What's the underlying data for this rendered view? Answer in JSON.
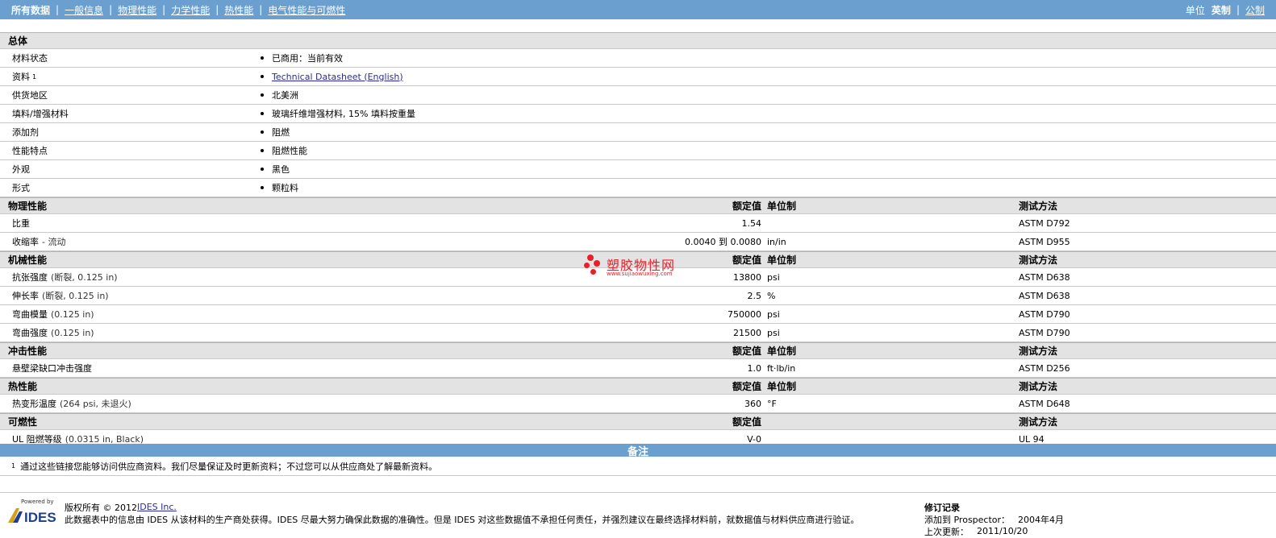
{
  "nav": {
    "tabs": [
      "所有数据",
      "一般信息",
      "物理性能",
      "力学性能",
      "热性能",
      "电气性能与可燃性"
    ],
    "separator": "|",
    "units_label": "单位",
    "unit_imperial": "英制",
    "unit_metric": "公制"
  },
  "general": {
    "title": "总体",
    "rows": [
      {
        "name": "材料状态",
        "sup": "",
        "value": "已商用：当前有效",
        "link": false
      },
      {
        "name": "资料",
        "sup": "1",
        "value": "Technical Datasheet (English)",
        "link": true
      },
      {
        "name": "供货地区",
        "sup": "",
        "value": "北美洲",
        "link": false
      },
      {
        "name": "填料/增强材料",
        "sup": "",
        "value": "玻璃纤维增强材料, 15% 填料按重量",
        "link": false
      },
      {
        "name": "添加剂",
        "sup": "",
        "value": "阻燃",
        "link": false
      },
      {
        "name": "性能特点",
        "sup": "",
        "value": "阻燃性能",
        "link": false
      },
      {
        "name": "外观",
        "sup": "",
        "value": "黑色",
        "link": false
      },
      {
        "name": "形式",
        "sup": "",
        "value": "颗粒料",
        "link": false
      }
    ]
  },
  "col_headers": {
    "value": "额定值",
    "unit": "单位制",
    "method": "测试方法"
  },
  "sections": [
    {
      "title": "物理性能",
      "has_unit": true,
      "rows": [
        {
          "name": "比重",
          "cond": "",
          "value": "1.54",
          "unit": "",
          "method": "ASTM D792"
        },
        {
          "name": "收缩率",
          "cond": "- 流动",
          "value": "0.0040 到  0.0080",
          "unit": "in/in",
          "method": "ASTM D955"
        }
      ]
    },
    {
      "title": "机械性能",
      "has_unit": true,
      "rows": [
        {
          "name": "抗张强度",
          "cond": "(断裂, 0.125 in)",
          "value": "13800",
          "unit": "psi",
          "method": "ASTM D638"
        },
        {
          "name": "伸长率",
          "cond": "(断裂, 0.125 in)",
          "value": "2.5",
          "unit": "%",
          "method": "ASTM D638"
        },
        {
          "name": "弯曲模量",
          "cond": "(0.125 in)",
          "value": "750000",
          "unit": "psi",
          "method": "ASTM D790"
        },
        {
          "name": "弯曲强度",
          "cond": "(0.125 in)",
          "value": "21500",
          "unit": "psi",
          "method": "ASTM D790"
        }
      ]
    },
    {
      "title": "冲击性能",
      "has_unit": true,
      "rows": [
        {
          "name": "悬壁梁缺口冲击强度",
          "cond": "",
          "value": "1.0",
          "unit": "ft·lb/in",
          "method": "ASTM D256"
        }
      ]
    },
    {
      "title": "热性能",
      "has_unit": true,
      "rows": [
        {
          "name": "热变形温度",
          "cond": "(264 psi, 未退火)",
          "value": "360",
          "unit": "°F",
          "method": "ASTM D648"
        }
      ]
    },
    {
      "title": "可燃性",
      "has_unit": false,
      "rows": [
        {
          "name": "UL 阻燃等级",
          "cond": "(0.0315 in, Black)",
          "value": "V-0",
          "unit": "",
          "method": "UL 94"
        }
      ]
    }
  ],
  "notes": {
    "title": "备注",
    "sup": "1",
    "text": "通过这些链接您能够访问供应商资料。我们尽量保证及时更新资料；不过您可以从供应商处了解最新资料。"
  },
  "footer": {
    "logo_powered": "Powered by",
    "logo_brand": "IDES",
    "copyright_prefix": "版权所有 © 2012 ",
    "copyright_link": "IDES Inc.",
    "disclaimer": "此数据表中的信息由 IDES 从该材料的生产商处获得。IDES 尽最大努力确保此数据的准确性。但是 IDES 对这些数据值不承担任何责任，并强烈建议在最终选择材料前，就数据值与材料供应商进行验证。",
    "revision_title": "修订记录",
    "added_label": "添加到 Prospector：",
    "added_value": "2004年4月",
    "updated_label": "上次更新：",
    "updated_value": "2011/10/20"
  },
  "watermark": {
    "title": "塑胶物性网",
    "url": "www.sujiaowuxing.com",
    "color": "#e8202a"
  },
  "colors": {
    "bar": "#6b9fcf",
    "header_bg": "#e3e3e3",
    "link": "#2a2aa8"
  }
}
